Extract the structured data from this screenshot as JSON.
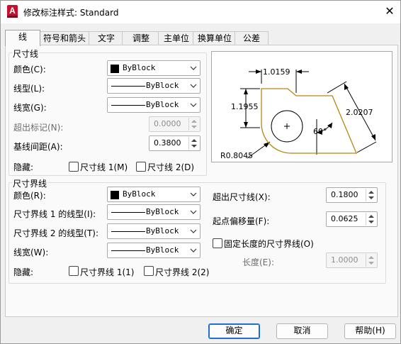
{
  "window": {
    "title": "修改标注样式: Standard",
    "app_icon": "A",
    "close_glyph": "✕"
  },
  "tabs": [
    {
      "label": "线",
      "active": true
    },
    {
      "label": "符号和箭头"
    },
    {
      "label": "文字"
    },
    {
      "label": "调整"
    },
    {
      "label": "主单位"
    },
    {
      "label": "换算单位"
    },
    {
      "label": "公差"
    }
  ],
  "dim_lines": {
    "group_label": "尺寸线",
    "color_label": "颜色(C):",
    "color_value": "ByBlock",
    "linetype_label": "线型(L):",
    "linetype_value": "ByBlock",
    "lineweight_label": "线宽(G):",
    "lineweight_value": "ByBlock",
    "extend_label": "超出标记(N):",
    "extend_value": "0.0000",
    "baseline_label": "基线间距(A):",
    "baseline_value": "0.3800",
    "suppress_label": "隐藏:",
    "suppress1_label": "尺寸线 1(M)",
    "suppress2_label": "尺寸线 2(D)"
  },
  "ext_lines": {
    "group_label": "尺寸界线",
    "color_label": "颜色(R):",
    "color_value": "ByBlock",
    "lt1_label": "尺寸界线 1 的线型(I):",
    "lt1_value": "ByBlock",
    "lt2_label": "尺寸界线 2 的线型(T):",
    "lt2_value": "ByBlock",
    "lineweight_label": "线宽(W):",
    "lineweight_value": "ByBlock",
    "suppress_label": "隐藏:",
    "suppress1_label": "尺寸界线 1(1)",
    "suppress2_label": "尺寸界线 2(2)",
    "beyond_label": "超出尺寸线(X):",
    "beyond_value": "0.1800",
    "offset_label": "起点偏移量(F):",
    "offset_value": "0.0625",
    "fixed_label": "固定长度的尺寸界线(O)",
    "length_label": "长度(E):",
    "length_value": "1.0000"
  },
  "preview": {
    "dim_top": "1.0159",
    "dim_left": "1.1955",
    "dim_right": "2.0207",
    "dim_angle": "60°",
    "dim_radius": "R0.8045",
    "shape_color": "#b8860b"
  },
  "buttons": {
    "ok": "确定",
    "cancel": "取消",
    "help": "帮助(H)"
  }
}
